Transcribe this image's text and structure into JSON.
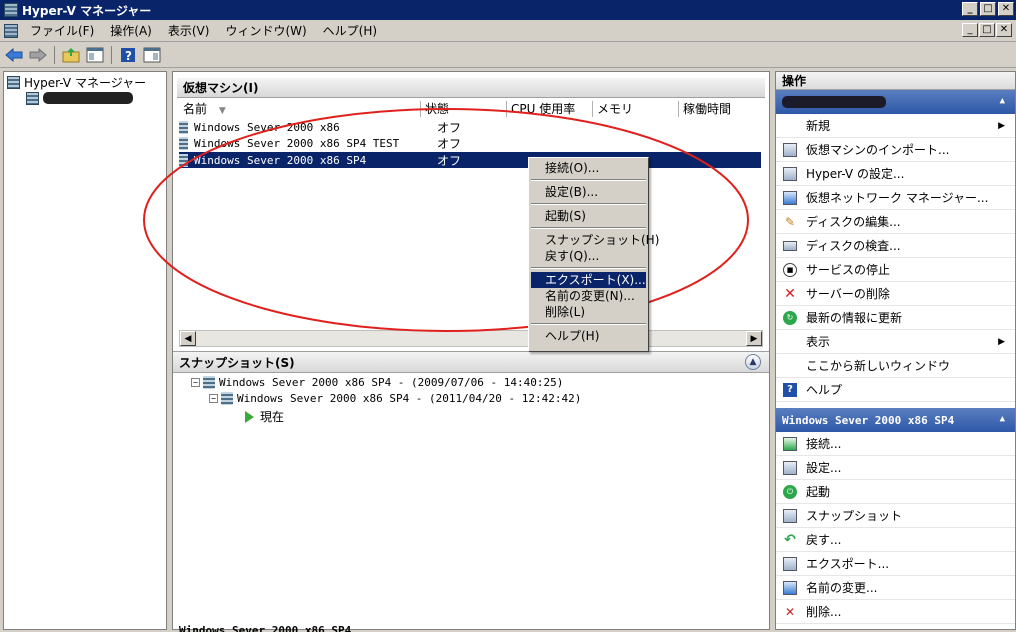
{
  "window": {
    "title": "Hyper-V マネージャー",
    "min": "_",
    "max": "□",
    "close": "✕"
  },
  "menu": {
    "items": [
      "ファイル(F)",
      "操作(A)",
      "表示(V)",
      "ウィンドウ(W)",
      "ヘルプ(H)"
    ]
  },
  "tree": {
    "root": "Hyper-V マネージャー"
  },
  "vm_section": {
    "title": "仮想マシン(I)",
    "columns": [
      "名前",
      "状態",
      "CPU 使用率",
      "メモリ",
      "稼働時間"
    ],
    "rows": [
      {
        "name": "Windows Sever 2000 x86",
        "state": "オフ"
      },
      {
        "name": "Windows Sever 2000 x86 SP4 TEST",
        "state": "オフ"
      },
      {
        "name": "Windows Sever 2000 x86 SP4",
        "state": "オフ"
      }
    ]
  },
  "context_menu": {
    "items": [
      "接続(O)...",
      "設定(B)...",
      "起動(S)",
      "スナップショット(H)",
      "戻す(Q)...",
      "エクスポート(X)...",
      "名前の変更(N)...",
      "削除(L)",
      "ヘルプ(H)"
    ]
  },
  "snapshot_section": {
    "title": "スナップショット(S)",
    "items": [
      "Windows Sever 2000 x86 SP4 - (2009/07/06 - 14:40:25)",
      "Windows Sever 2000 x86 SP4 - (2011/04/20 - 12:42:42)",
      "現在"
    ]
  },
  "bottom_label": "Windows Sever 2000 x86 SP4",
  "actions": {
    "title": "操作",
    "server_items": [
      "新規",
      "仮想マシンのインポート...",
      "Hyper-V の設定...",
      "仮想ネットワーク マネージャー...",
      "ディスクの編集...",
      "ディスクの検査...",
      "サービスの停止",
      "サーバーの削除",
      "最新の情報に更新",
      "表示",
      "ここから新しいウィンドウ",
      "ヘルプ"
    ],
    "vm_group_title": "Windows Sever 2000 x86 SP4",
    "vm_items": [
      "接続...",
      "設定...",
      "起動",
      "スナップショット",
      "戻す...",
      "エクスポート...",
      "名前の変更...",
      "削除..."
    ]
  },
  "colors": {
    "selection": "#0a246a",
    "annotation_ellipse": "#e0201c",
    "group_header": "#2e58a8"
  }
}
